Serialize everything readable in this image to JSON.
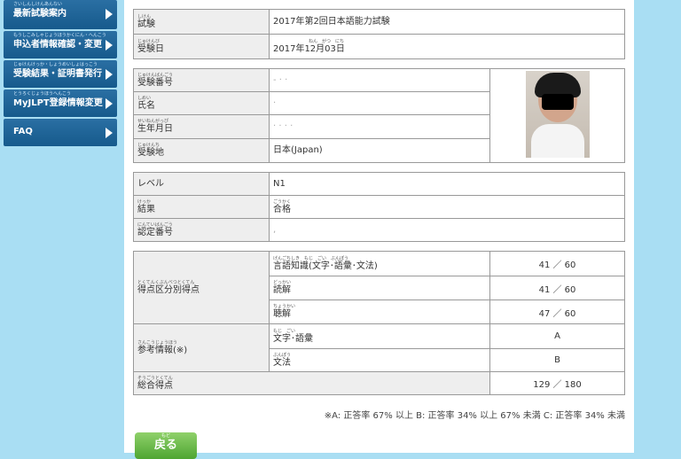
{
  "sidebar": {
    "items": [
      {
        "ruby": "さいしんしけんあんない",
        "label": "最新試験案内"
      },
      {
        "ruby": "もうしこみしゃじょうほうかくにん・へんこう",
        "label": "申込者情報確認・変更"
      },
      {
        "ruby": "じゅけんけっか・しょうめいしょはっこう",
        "label": "受験結果・証明書発行"
      },
      {
        "ruby": "とうろくじょうほうへんこう",
        "label": "MyJLPT登録情報変更"
      },
      {
        "ruby": "",
        "label": "FAQ"
      }
    ]
  },
  "exam": {
    "exam_ruby": "しけん",
    "exam_label": "試験",
    "exam_value": "2017年第2回日本語能力試験",
    "date_ruby": "じゅけんび",
    "date_label": "受験日",
    "date_value_ruby": "ねん　がつ　にち",
    "date_value": "2017年12月03日"
  },
  "profile": {
    "number_ruby": "じゅけんばんごう",
    "number_label": "受験番号",
    "number_value": "- ·  ·",
    "name_ruby": "しめい",
    "name_label": "氏名",
    "name_value": "·",
    "birth_ruby": "せいねんがっぴ",
    "birth_label": "生年月日",
    "birth_value": "· · · ·",
    "place_ruby": "じゅけんち",
    "place_label": "受験地",
    "place_value": "日本(Japan)"
  },
  "result": {
    "level_label": "レベル",
    "level_value": "N1",
    "result_ruby": "けっか",
    "result_label": "結果",
    "result_value_ruby": "ごうかく",
    "result_value": "合格",
    "cert_ruby": "にんていばんごう",
    "cert_label": "認定番号",
    "cert_value": ","
  },
  "scores": {
    "section_ruby": "とくてんくぶんべつとくてん",
    "section_label": "得点区分別得点",
    "rows": [
      {
        "ruby": "げんごちしき　もじ　ごい　ぶんぽう",
        "label": "言語知識(文字･語彙･文法)",
        "score": "41 ／ 60"
      },
      {
        "ruby": "どっかい",
        "label": "読解",
        "score": "41 ／ 60"
      },
      {
        "ruby": "ちょうかい",
        "label": "聴解",
        "score": "47 ／ 60"
      }
    ],
    "ref_ruby": "さんこうじょうほう",
    "ref_label": "参考情報(※)",
    "ref_rows": [
      {
        "ruby": "もじ　ごい",
        "label": "文字･語彙",
        "grade": "A"
      },
      {
        "ruby": "ぶんぽう",
        "label": "文法",
        "grade": "B"
      }
    ],
    "total_ruby": "そうごうとくてん",
    "total_label": "総合得点",
    "total_value": "129 ／ 180"
  },
  "note": "※A: 正答率 67% 以上  B: 正答率 34% 以上 67% 未満  C: 正答率 34% 未満",
  "back_button": {
    "ruby": "もど",
    "label": "戻る"
  }
}
